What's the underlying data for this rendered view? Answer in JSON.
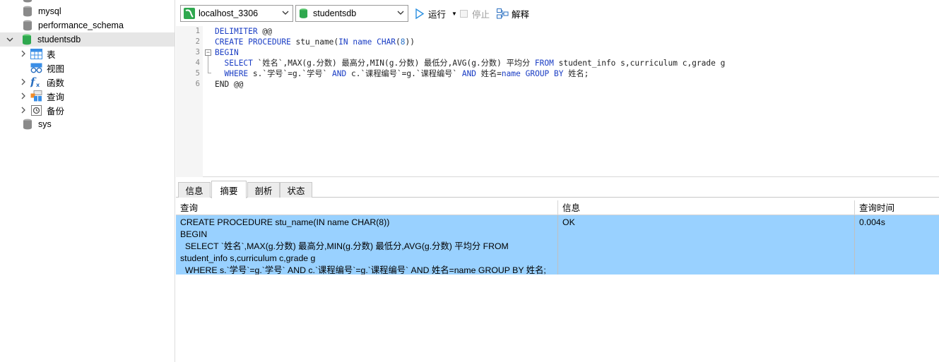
{
  "sidebar": {
    "items": [
      {
        "label": "",
        "chevron": ""
      },
      {
        "label": "mysql",
        "chevron": ""
      },
      {
        "label": "performance_schema",
        "chevron": ""
      },
      {
        "label": "studentsdb",
        "chevron": "v"
      },
      {
        "label": "sys",
        "chevron": ""
      }
    ],
    "children": [
      {
        "label": "表",
        "icon": "table-icon",
        "chevron": ">"
      },
      {
        "label": "视图",
        "icon": "view-icon",
        "chevron": ""
      },
      {
        "label": "函数",
        "icon": "function-icon",
        "chevron": ">"
      },
      {
        "label": "查询",
        "icon": "query-icon",
        "chevron": ">"
      },
      {
        "label": "备份",
        "icon": "backup-icon",
        "chevron": ">"
      }
    ]
  },
  "toolbar": {
    "connection": "localhost_3306",
    "database": "studentsdb",
    "run_label": "运行",
    "stop_label": "停止",
    "explain_label": "解释"
  },
  "editor": {
    "line_numbers": [
      "1",
      "2",
      "3",
      "4",
      "5",
      "6"
    ],
    "lines": [
      "DELIMITER @@",
      "CREATE PROCEDURE stu_name(IN name CHAR(8))",
      "BEGIN",
      "  SELECT `姓名`,MAX(g.分数) 最高分,MIN(g.分数) 最低分,AVG(g.分数) 平均分 FROM student_info s,curriculum c,grade g",
      "  WHERE s.`学号`=g.`学号` AND c.`课程编号`=g.`课程编号` AND 姓名=name GROUP BY 姓名;",
      "END @@"
    ]
  },
  "result_tabs": [
    "信息",
    "摘要",
    "剖析",
    "状态"
  ],
  "grid": {
    "columns": [
      "查询",
      "信息",
      "查询时间"
    ],
    "rows": [
      {
        "query": "CREATE PROCEDURE stu_name(IN name CHAR(8))\nBEGIN\n  SELECT `姓名`,MAX(g.分数) 最高分,MIN(g.分数) 最低分,AVG(g.分数) 平均分 FROM\nstudent_info s,curriculum c,grade g\n  WHERE s.`学号`=g.`学号` AND c.`课程编号`=g.`课程编号` AND 姓名=name GROUP BY 姓名;",
        "info": "OK",
        "time": "0.004s"
      }
    ]
  },
  "colors": {
    "selected_row": "#99d1ff",
    "keyword": "#1a3dc4",
    "db_icon": "#8a8a8a",
    "db_icon_active": "#2fa84f"
  }
}
